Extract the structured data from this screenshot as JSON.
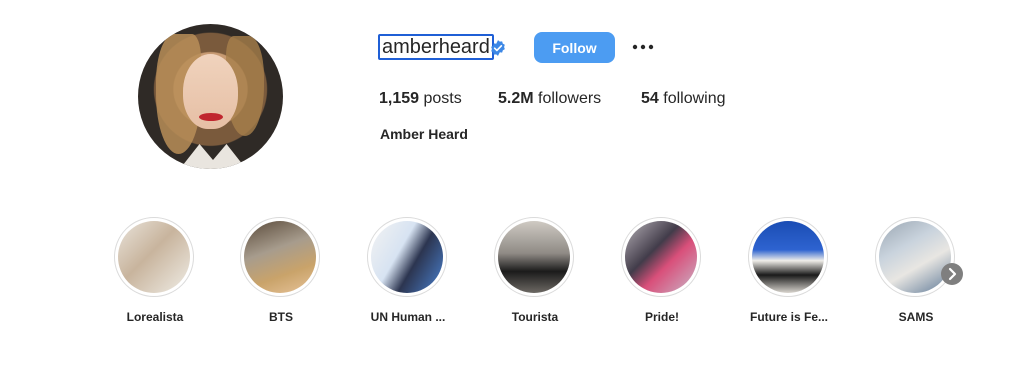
{
  "profile": {
    "username": "amberheard",
    "full_name": "Amber Heard",
    "follow_label": "Follow",
    "stats": {
      "posts_count": "1,159",
      "posts_label": "posts",
      "followers_count": "5.2M",
      "followers_label": "followers",
      "following_count": "54",
      "following_label": "following"
    }
  },
  "highlights": [
    {
      "label": "Lorealista"
    },
    {
      "label": "BTS"
    },
    {
      "label": "UN Human ..."
    },
    {
      "label": "Tourista"
    },
    {
      "label": "Pride!"
    },
    {
      "label": "Future is Fe..."
    },
    {
      "label": "SAMS"
    }
  ],
  "colors": {
    "follow_button": "#4c9cf2",
    "verified_badge": "#3d88e6",
    "text": "#262626"
  },
  "icons": {
    "verified": "verified-badge-icon",
    "more": "more-options-icon",
    "next": "chevron-right-icon"
  }
}
